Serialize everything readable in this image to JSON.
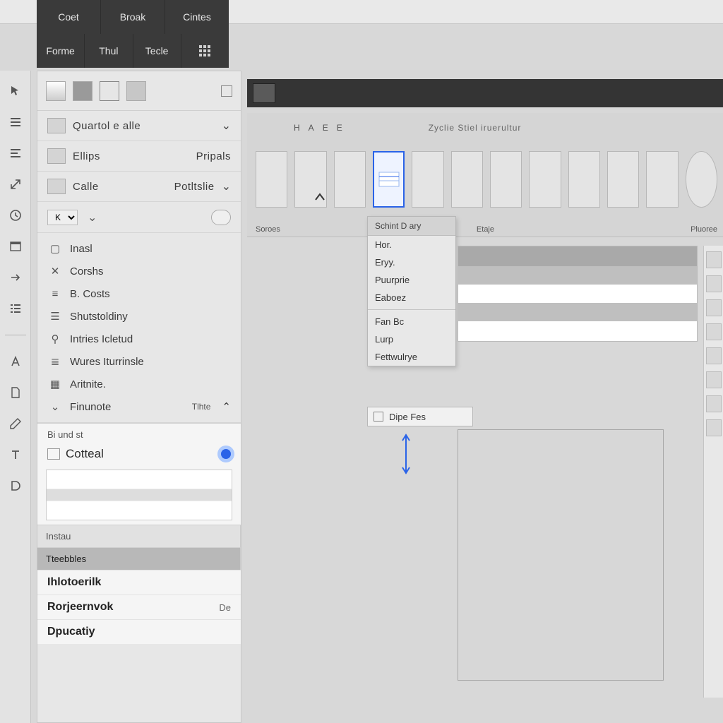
{
  "menu": {
    "row1": [
      "Coet",
      "Broak",
      "Cintes"
    ],
    "row2": [
      "Forme",
      "Thul",
      "Tecle"
    ]
  },
  "toolstrip_icons": [
    "cursor-icon",
    "bars-icon",
    "menu-icon",
    "resize-icon",
    "clock-icon",
    "panel-icon",
    "arrow-icon",
    "list-icon"
  ],
  "toolstrip_icons2": [
    "font-icon",
    "doc-icon",
    "measure-icon",
    "text-icon",
    "d-icon"
  ],
  "side": {
    "combo1": "Quartol e alle",
    "combo2a": "Ellips",
    "combo2b": "Pripals",
    "combo3a": "Calle",
    "combo3b": "Potltslie",
    "minisel": "K",
    "list": [
      {
        "icon": "square-icon",
        "label": "Inasl"
      },
      {
        "icon": "cross-icon",
        "label": "Corshs"
      },
      {
        "icon": "bars2-icon",
        "label": "B. Costs"
      },
      {
        "icon": "rows-icon",
        "label": "Shutstoldiny"
      },
      {
        "icon": "anchor-icon",
        "label": "Intries Icletud"
      },
      {
        "icon": "lines-icon",
        "label": "Wures Iturrinsle"
      },
      {
        "icon": "grid-icon",
        "label": "Aritnite."
      },
      {
        "icon": "chev-icon",
        "label": "Finunote",
        "sub": "Tlhte"
      }
    ],
    "footer": {
      "head": "Bi und st",
      "cotteal": "Cotteal",
      "tab_a": "Instau",
      "tab_b": "Tteebbles",
      "last": [
        {
          "label": "Ihlotoerilk",
          "tag": ""
        },
        {
          "label": "Rorjeernvok",
          "tag": "De"
        },
        {
          "label": "Dpucatiy",
          "tag": ""
        }
      ]
    }
  },
  "ribbon": {
    "hint_letters": [
      "H",
      "A",
      "E",
      "E"
    ],
    "hint_text": "Zyclie Stiel iruerultur",
    "group_labels": [
      "Soroes",
      "",
      "Etaje",
      "",
      "Pluoree"
    ]
  },
  "popover": {
    "header": "Schint D ary",
    "items": [
      "Hor.",
      "Eryy.",
      "Puurprie",
      "Eaboez"
    ],
    "items2": [
      "Fan Bc",
      "Lurp",
      "Fettwulrye"
    ]
  },
  "chipbtn": {
    "label": "Dipe Fes"
  },
  "colors": {
    "accent": "#2a63e8"
  }
}
